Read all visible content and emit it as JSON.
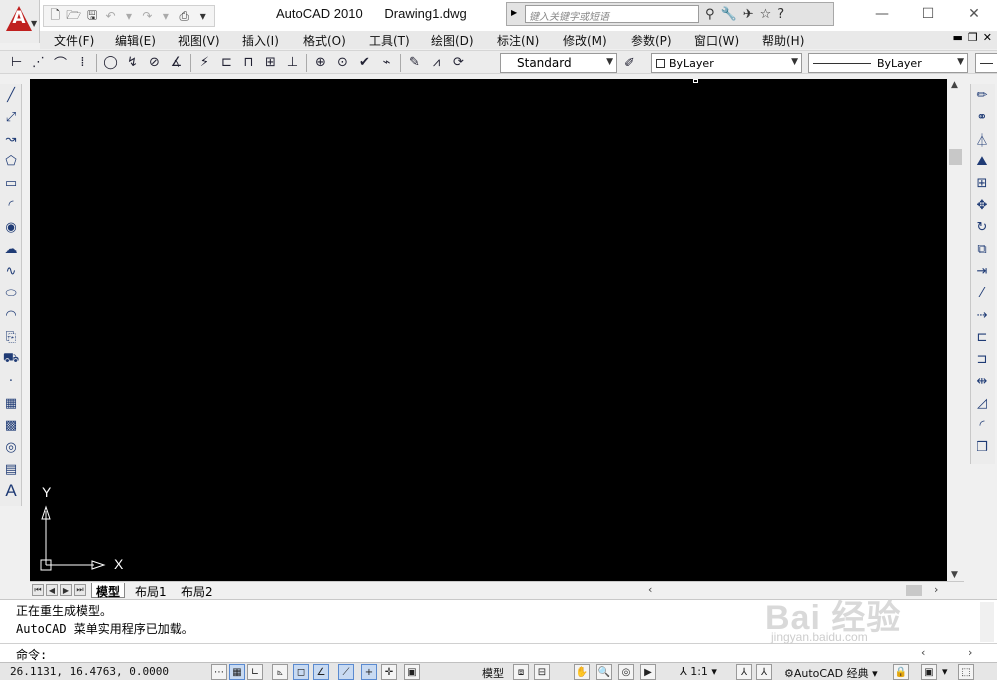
{
  "title_bar": {
    "app_name": "AutoCAD 2010",
    "document_name": "Drawing1.dwg",
    "search_placeholder": "键入关键字或短语",
    "accent_color": "#c0201f"
  },
  "menu": {
    "items": [
      "文件(F)",
      "编辑(E)",
      "视图(V)",
      "插入(I)",
      "格式(O)",
      "工具(T)",
      "绘图(D)",
      "标注(N)",
      "修改(M)",
      "参数(P)",
      "窗口(W)",
      "帮助(H)"
    ]
  },
  "toolbar": {
    "text_style": "Standard",
    "layer_value": "ByLayer",
    "linetype_value": "ByLayer"
  },
  "canvas": {
    "background_color": "#000000",
    "ucs_x_label": "X",
    "ucs_y_label": "Y"
  },
  "layout_tabs": {
    "tabs": [
      "模型",
      "布局1",
      "布局2"
    ],
    "active": "模型"
  },
  "command_window": {
    "history": [
      "正在重生成模型。",
      "AutoCAD 菜单实用程序已加载。"
    ],
    "prompt": "命令:"
  },
  "status_bar": {
    "coordinates": "26.1131, 16.4763, 0.0000",
    "model_label": "模型",
    "annotation_scale": "1:1",
    "workspace": "AutoCAD 经典"
  },
  "watermark": {
    "text": "Bai 经验",
    "url": "jingyan.baidu.com"
  }
}
